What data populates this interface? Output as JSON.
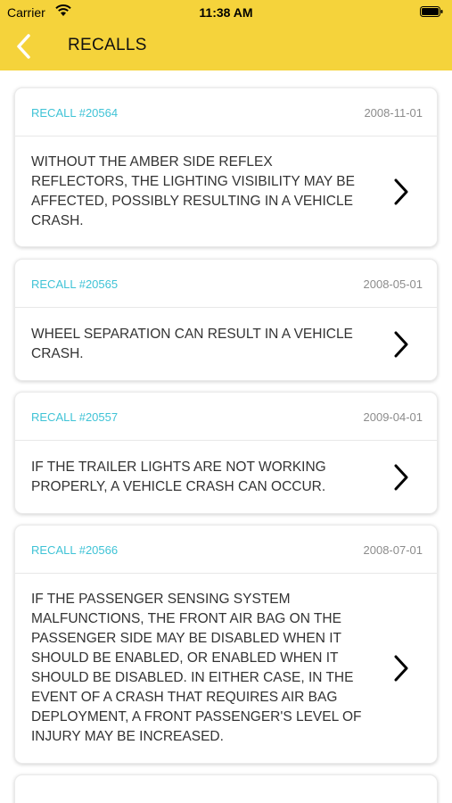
{
  "status_bar": {
    "carrier": "Carrier",
    "time": "11:38 AM"
  },
  "header": {
    "title": "RECALLS"
  },
  "recalls": [
    {
      "id": "RECALL #20564",
      "date": "2008-11-01",
      "description": "WITHOUT THE AMBER SIDE REFLEX REFLECTORS, THE LIGHTING VISIBILITY MAY BE AFFECTED, POSSIBLY RESULTING IN A VEHICLE CRASH."
    },
    {
      "id": "RECALL #20565",
      "date": "2008-05-01",
      "description": "WHEEL SEPARATION CAN RESULT IN A VEHICLE CRASH."
    },
    {
      "id": "RECALL #20557",
      "date": "2009-04-01",
      "description": "IF THE TRAILER LIGHTS ARE NOT WORKING PROPERLY, A VEHICLE CRASH CAN OCCUR."
    },
    {
      "id": "RECALL #20566",
      "date": "2008-07-01",
      "description": "IF THE PASSENGER SENSING SYSTEM MALFUNCTIONS, THE FRONT AIR BAG ON THE PASSENGER SIDE MAY BE DISABLED WHEN IT SHOULD BE ENABLED, OR ENABLED WHEN IT SHOULD BE DISABLED.  IN EITHER CASE, IN THE EVENT OF A CRASH THAT REQUIRES AIR BAG DEPLOYMENT, A FRONT PASSENGER'S LEVEL OF INJURY MAY BE INCREASED."
    }
  ],
  "icons": {
    "back": "chevron-left-icon",
    "row": "chevron-right-icon",
    "wifi": "wifi-icon",
    "battery": "battery-icon"
  },
  "colors": {
    "header": "#f5d33b",
    "recall_id": "#3fc3d6",
    "date": "#8c8c8c"
  }
}
